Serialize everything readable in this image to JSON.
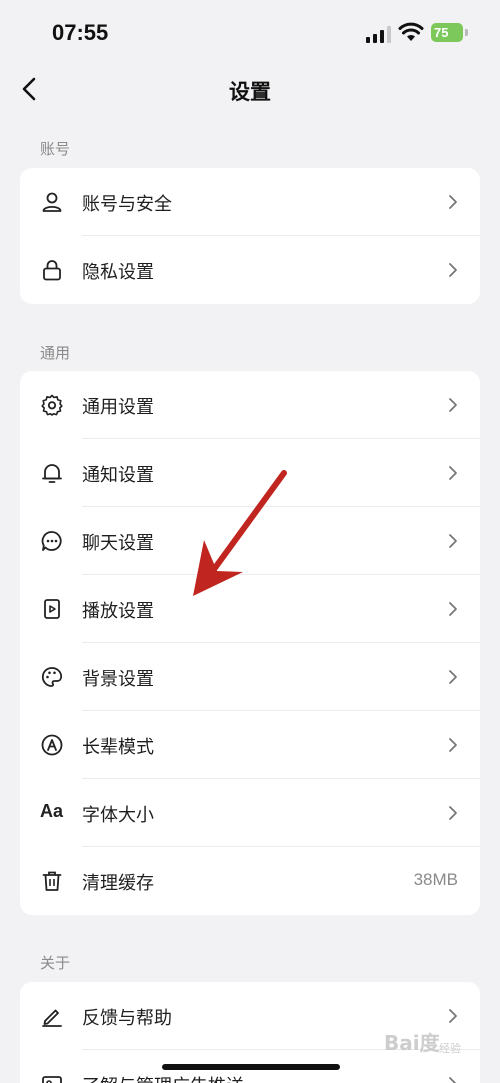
{
  "status_bar": {
    "time": "07:55",
    "battery": "75"
  },
  "header": {
    "title": "设置"
  },
  "sections": [
    {
      "label": "账号",
      "items": [
        {
          "icon": "user-icon",
          "label": "账号与安全"
        },
        {
          "icon": "lock-icon",
          "label": "隐私设置"
        }
      ]
    },
    {
      "label": "通用",
      "items": [
        {
          "icon": "gear-icon",
          "label": "通用设置"
        },
        {
          "icon": "bell-icon",
          "label": "通知设置"
        },
        {
          "icon": "chat-bubble-icon",
          "label": "聊天设置"
        },
        {
          "icon": "play-icon",
          "label": "播放设置"
        },
        {
          "icon": "palette-icon",
          "label": "背景设置"
        },
        {
          "icon": "elder-mode-icon",
          "label": "长辈模式"
        },
        {
          "icon": "font-size-icon",
          "icon_text": "Aa",
          "label": "字体大小"
        },
        {
          "icon": "trash-icon",
          "label": "清理缓存",
          "value": "38MB"
        }
      ]
    },
    {
      "label": "关于",
      "items": [
        {
          "icon": "pencil-icon",
          "label": "反馈与帮助"
        },
        {
          "icon": "ad-icon",
          "label": "了解与管理广告推送"
        }
      ]
    }
  ],
  "annotation": {
    "color": "#c0251f"
  },
  "watermark": {
    "text": "Bai度",
    "sub": "经验"
  }
}
